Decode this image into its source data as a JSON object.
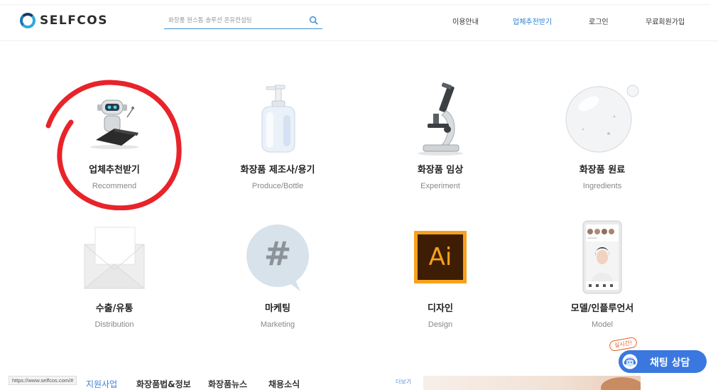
{
  "header": {
    "logo_text": "SELFCOS",
    "search_placeholder": "화장품 원스톱 솔루션 온유컨설팅",
    "nav": [
      {
        "label": "이용안내",
        "active": false
      },
      {
        "label": "업체추천받기",
        "active": true
      },
      {
        "label": "로그인",
        "active": false
      },
      {
        "label": "무료회원가입",
        "active": false
      }
    ]
  },
  "categories": [
    {
      "title": "업체추천받기",
      "subtitle": "Recommend",
      "icon": "robot-laptop-icon"
    },
    {
      "title": "화장품 제조사/용기",
      "subtitle": "Produce/Bottle",
      "icon": "pump-bottle-icon"
    },
    {
      "title": "화장품 임상",
      "subtitle": "Experiment",
      "icon": "microscope-icon"
    },
    {
      "title": "화장품 원료",
      "subtitle": "Ingredients",
      "icon": "bubble-icon"
    },
    {
      "title": "수출/유통",
      "subtitle": "Distribution",
      "icon": "envelope-icon"
    },
    {
      "title": "마케팅",
      "subtitle": "Marketing",
      "icon": "hashtag-bubble-icon"
    },
    {
      "title": "디자인",
      "subtitle": "Design",
      "icon": "illustrator-icon"
    },
    {
      "title": "모델/인플루언서",
      "subtitle": "Model",
      "icon": "phone-model-icon"
    }
  ],
  "illustrator_text": "Ai",
  "hashtag_text": "#",
  "bottom": {
    "status_url": "https://www.selfcos.com/#",
    "tabs": [
      "지원사업",
      "화장품법&정보",
      "화장품뉴스",
      "채용소식"
    ],
    "more_label": "더보기"
  },
  "chat": {
    "label": "채팅 상담",
    "badge": "실시간!"
  },
  "colors": {
    "accent": "#2f80d0",
    "chat": "#3a78df",
    "highlight_circle": "#e8232a",
    "ai_orange": "#f7a11b",
    "ai_dark": "#3d1e05"
  }
}
